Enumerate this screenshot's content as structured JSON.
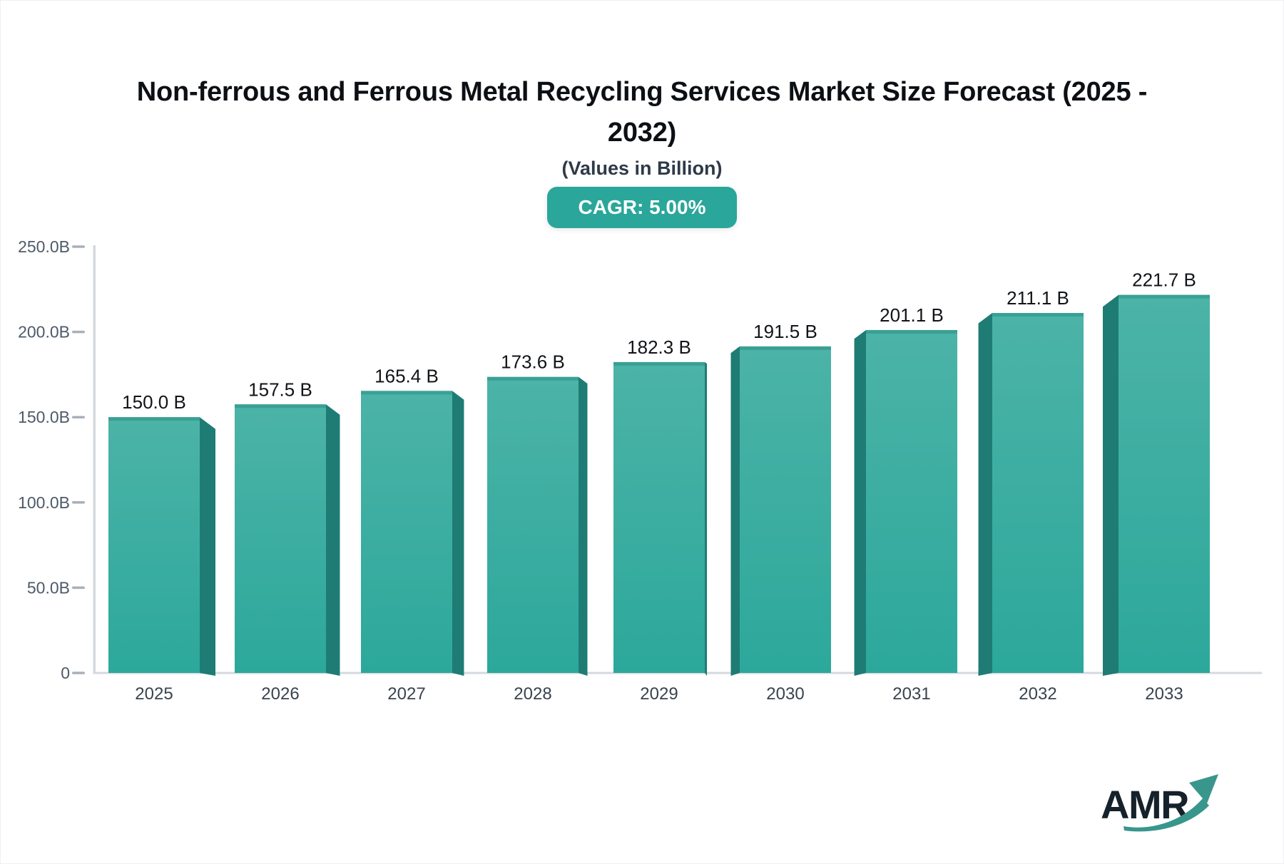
{
  "header": {
    "title_line1": "Non-ferrous and Ferrous Metal Recycling Services Market Size Forecast (2025 -",
    "title_line2": "2032)",
    "subtitle": "(Values in Billion)",
    "cagr_label": "CAGR: 5.00%"
  },
  "chart_data": {
    "type": "bar",
    "title": "Non-ferrous and Ferrous Metal Recycling Services Market Size Forecast (2025 - 2032)",
    "subtitle": "(Values in Billion)",
    "cagr": "5.00%",
    "categories": [
      "2025",
      "2026",
      "2027",
      "2028",
      "2029",
      "2030",
      "2031",
      "2032",
      "2033"
    ],
    "values": [
      150.0,
      157.5,
      165.4,
      173.6,
      182.3,
      191.5,
      201.1,
      211.1,
      221.7
    ],
    "value_labels": [
      "150.0 B",
      "157.5 B",
      "165.4 B",
      "173.6 B",
      "182.3 B",
      "191.5 B",
      "201.1 B",
      "211.1 B",
      "221.7 B"
    ],
    "xlabel": "",
    "ylabel": "",
    "ylim": [
      0,
      250
    ],
    "yticks": [
      {
        "value": 0,
        "label": "0"
      },
      {
        "value": 50,
        "label": "50.0B"
      },
      {
        "value": 100,
        "label": "100.0B"
      },
      {
        "value": 150,
        "label": "150.0B"
      },
      {
        "value": 200,
        "label": "200.0B"
      },
      {
        "value": 250,
        "label": "250.0B"
      }
    ],
    "grid": "off",
    "legend": "none",
    "bar_style": "3d-perspective",
    "colors": {
      "bar_face_top": "#4CB3A7",
      "bar_face_bottom": "#2CA89B",
      "bar_side": "#1E7C74",
      "bar_top": "#3AA095",
      "axis_line": "#D5D9DE",
      "tick_dash": "#A9B0BA",
      "tick_text": "#4D5A68",
      "category_text": "#39434F",
      "value_text": "#111418",
      "badge_bg": "#2AA69A",
      "badge_text": "#FFFFFF"
    }
  },
  "footer": {
    "logo_text": "AMR",
    "logo_color": "#15212B",
    "arrow_color": "#38968C"
  }
}
